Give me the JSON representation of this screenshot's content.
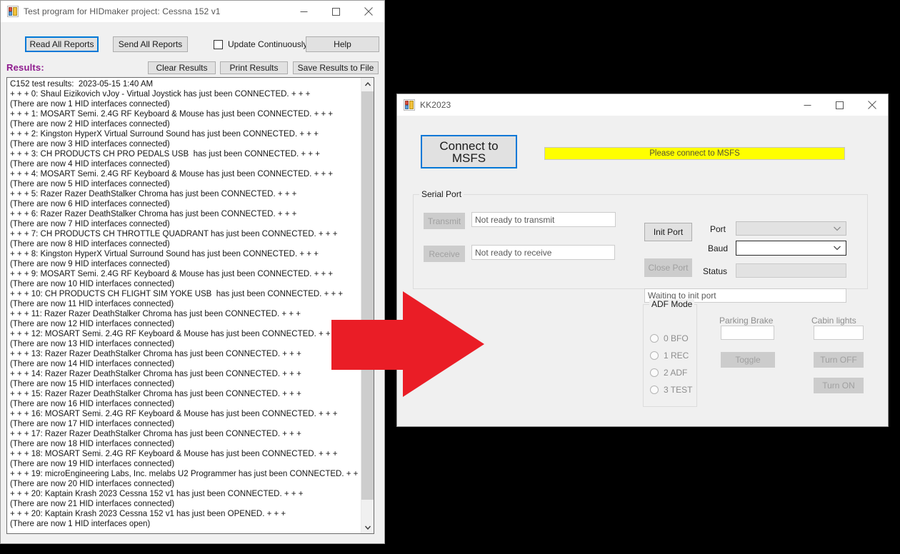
{
  "window1": {
    "title": "Test program for HIDmaker project: Cessna 152 v1",
    "icon": "app-icon",
    "titlebar_buttons": {
      "minimize": "minimize-icon",
      "maximize": "maximize-icon",
      "close": "close-icon"
    },
    "toolbar": {
      "read_all_reports": "Read All Reports",
      "send_all_reports": "Send All Reports",
      "update_continuously": "Update Continuously",
      "update_continuously_checked": false,
      "help": "Help",
      "clear_results": "Clear Results",
      "print_results": "Print Results",
      "save_results_to_file": "Save Results to File"
    },
    "results_label": "Results:",
    "results_label_color": "#8e1a8e",
    "results_text": "C152 test results:  2023-05-15 1:40 AM\n+ + + 0: Shaul Eizikovich vJoy - Virtual Joystick has just been CONNECTED. + + +\n(There are now 1 HID interfaces connected)\n+ + + 1: MOSART Semi. 2.4G RF Keyboard & Mouse has just been CONNECTED. + + +\n(There are now 2 HID interfaces connected)\n+ + + 2: Kingston HyperX Virtual Surround Sound has just been CONNECTED. + + +\n(There are now 3 HID interfaces connected)\n+ + + 3: CH PRODUCTS CH PRO PEDALS USB  has just been CONNECTED. + + +\n(There are now 4 HID interfaces connected)\n+ + + 4: MOSART Semi. 2.4G RF Keyboard & Mouse has just been CONNECTED. + + +\n(There are now 5 HID interfaces connected)\n+ + + 5: Razer Razer DeathStalker Chroma has just been CONNECTED. + + +\n(There are now 6 HID interfaces connected)\n+ + + 6: Razer Razer DeathStalker Chroma has just been CONNECTED. + + +\n(There are now 7 HID interfaces connected)\n+ + + 7: CH PRODUCTS CH THROTTLE QUADRANT has just been CONNECTED. + + +\n(There are now 8 HID interfaces connected)\n+ + + 8: Kingston HyperX Virtual Surround Sound has just been CONNECTED. + + +\n(There are now 9 HID interfaces connected)\n+ + + 9: MOSART Semi. 2.4G RF Keyboard & Mouse has just been CONNECTED. + + +\n(There are now 10 HID interfaces connected)\n+ + + 10: CH PRODUCTS CH FLIGHT SIM YOKE USB  has just been CONNECTED. + + +\n(There are now 11 HID interfaces connected)\n+ + + 11: Razer Razer DeathStalker Chroma has just been CONNECTED. + + +\n(There are now 12 HID interfaces connected)\n+ + + 12: MOSART Semi. 2.4G RF Keyboard & Mouse has just been CONNECTED. + + +\n(There are now 13 HID interfaces connected)\n+ + + 13: Razer Razer DeathStalker Chroma has just been CONNECTED. + + +\n(There are now 14 HID interfaces connected)\n+ + + 14: Razer Razer DeathStalker Chroma has just been CONNECTED. + + +\n(There are now 15 HID interfaces connected)\n+ + + 15: Razer Razer DeathStalker Chroma has just been CONNECTED. + + +\n(There are now 16 HID interfaces connected)\n+ + + 16: MOSART Semi. 2.4G RF Keyboard & Mouse has just been CONNECTED. + + +\n(There are now 17 HID interfaces connected)\n+ + + 17: Razer Razer DeathStalker Chroma has just been CONNECTED. + + +\n(There are now 18 HID interfaces connected)\n+ + + 18: MOSART Semi. 2.4G RF Keyboard & Mouse has just been CONNECTED. + + +\n(There are now 19 HID interfaces connected)\n+ + + 19: microEngineering Labs, Inc. melabs U2 Programmer has just been CONNECTED. + + +\n(There are now 20 HID interfaces connected)\n+ + + 20: Kaptain Krash 2023 Cessna 152 v1 has just been CONNECTED. + + +\n(There are now 21 HID interfaces connected)\n+ + + 20: Kaptain Krash 2023 Cessna 152 v1 has just been OPENED. + + +\n(There are now 1 HID interfaces open)"
  },
  "window2": {
    "title": "KK2023",
    "icon": "app-icon",
    "titlebar_buttons": {
      "minimize": "minimize-icon",
      "maximize": "maximize-icon",
      "close": "close-icon"
    },
    "connect_button": "Connect to MSFS",
    "status_banner": {
      "text": "Please connect to MSFS",
      "background": "#ffff00"
    },
    "serial_port": {
      "group_title": "Serial Port",
      "transmit_button": "Transmit",
      "transmit_status": "Not ready to transmit",
      "receive_button": "Receive",
      "receive_status": "Not ready to receive",
      "init_port_button": "Init Port",
      "close_port_button": "Close Port",
      "port_label": "Port",
      "port_value": "",
      "baud_label": "Baud",
      "baud_value": "",
      "status_label": "Status",
      "status_value": "",
      "waiting_message": "Waiting to init port"
    },
    "adf_mode": {
      "group_title": "ADF Mode",
      "options": [
        {
          "label": "0 BFO",
          "selected": false
        },
        {
          "label": "1 REC",
          "selected": false
        },
        {
          "label": "2 ADF",
          "selected": false
        },
        {
          "label": "3 TEST",
          "selected": false
        }
      ]
    },
    "parking_brake": {
      "label": "Parking Brake",
      "value": "",
      "toggle_button": "Toggle"
    },
    "cabin_lights": {
      "label": "Cabin lights",
      "value": "",
      "turn_off_button": "Turn OFF",
      "turn_on_button": "Turn ON"
    }
  },
  "annotation": {
    "arrow": "red-right-arrow",
    "color": "#ea1d26"
  }
}
